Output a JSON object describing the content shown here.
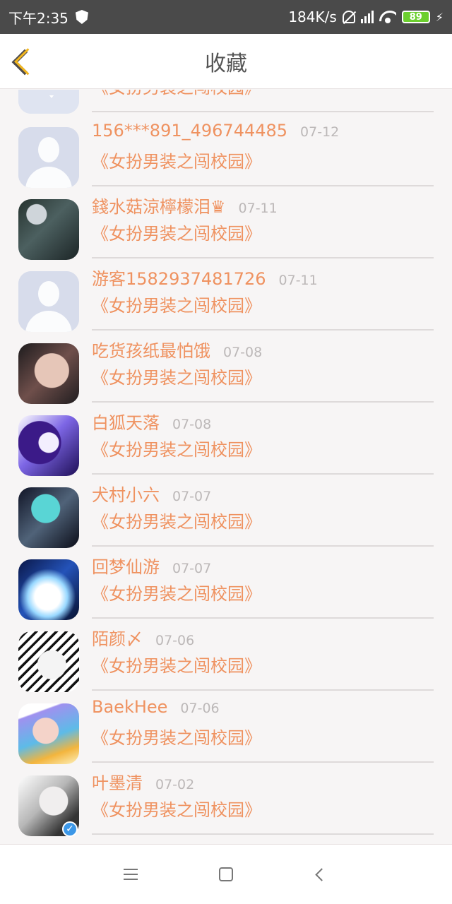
{
  "status": {
    "time": "下午2:35",
    "network_speed": "184K/s",
    "battery": "89"
  },
  "header": {
    "title": "收藏",
    "back_icon": "back-chevron-icon"
  },
  "favorites": [
    {
      "name": "",
      "date": "",
      "title": "《女扮男装之闯校园》"
    },
    {
      "name": "156***891_496744485",
      "date": "07-12",
      "title": "《女扮男装之闯校园》"
    },
    {
      "name": "錢水菇涼檸檬泪♛",
      "date": "07-11",
      "title": "《女扮男装之闯校园》"
    },
    {
      "name": "游客1582937481726",
      "date": "07-11",
      "title": "《女扮男装之闯校园》"
    },
    {
      "name": "吃货孩纸最怕饿",
      "date": "07-08",
      "title": "《女扮男装之闯校园》"
    },
    {
      "name": "白狐天落",
      "date": "07-08",
      "title": "《女扮男装之闯校园》"
    },
    {
      "name": "犬村小六",
      "date": "07-07",
      "title": "《女扮男装之闯校园》"
    },
    {
      "name": "回梦仙游",
      "date": "07-07",
      "title": "《女扮男装之闯校园》"
    },
    {
      "name": "陌颜〆",
      "date": "07-06",
      "title": "《女扮男装之闯校园》"
    },
    {
      "name": "BaekHee",
      "date": "07-06",
      "title": "《女扮男装之闯校园》"
    },
    {
      "name": "叶墨清",
      "date": "07-02",
      "title": "《女扮男装之闯校园》"
    }
  ],
  "colors": {
    "accent": "#ef9260",
    "date": "#bcb8b8",
    "back_arrow": "#f2b61d",
    "status_bar": "#4a4a4a"
  },
  "navigation": {
    "menu_icon": "menu-icon",
    "home_icon": "home-icon",
    "back_icon": "back-icon"
  }
}
